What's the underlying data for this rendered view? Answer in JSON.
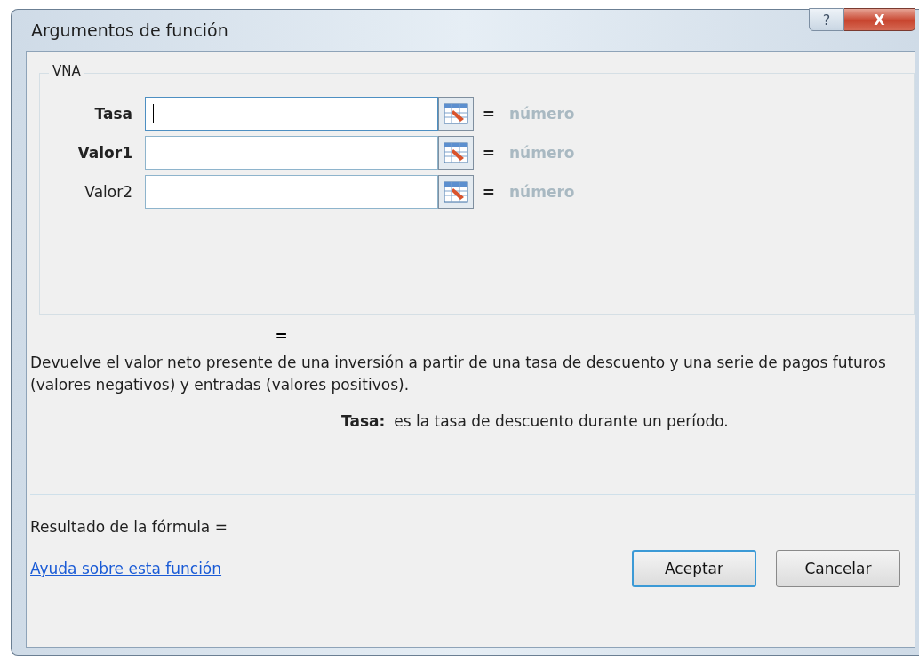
{
  "window": {
    "title": "Argumentos de función",
    "help_button": "?",
    "close_button": "X"
  },
  "function_group": {
    "name": "VNA",
    "arguments": [
      {
        "label": "Tasa",
        "required": true,
        "focused": true,
        "equals": "=",
        "result": "número"
      },
      {
        "label": "Valor1",
        "required": true,
        "focused": false,
        "equals": "=",
        "result": "número"
      },
      {
        "label": "Valor2",
        "required": false,
        "focused": false,
        "equals": "=",
        "result": "número"
      }
    ]
  },
  "result_equals": "=",
  "description": "Devuelve el valor neto presente de una inversión a partir de una tasa de descuento y una serie de pagos futuros (valores negativos) y entradas (valores positivos).",
  "argument_help": {
    "name": "Tasa:",
    "text": "es la tasa de descuento durante un período."
  },
  "formula_result": "Resultado de la fórmula =",
  "help_link": "Ayuda sobre esta función",
  "buttons": [
    {
      "label": "Aceptar",
      "default": true
    },
    {
      "label": "Cancelar",
      "default": false
    }
  ]
}
